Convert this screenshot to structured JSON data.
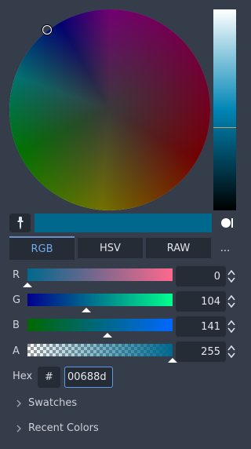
{
  "colors": {
    "panel_bg": "#363d4a",
    "control_bg": "#262c35",
    "accent": "#6ea8ef",
    "current_color": "#00688d"
  },
  "tabs": [
    {
      "label": "RGB",
      "active": true
    },
    {
      "label": "HSV",
      "active": false
    },
    {
      "label": "RAW",
      "active": false
    }
  ],
  "more_label": "...",
  "channels": [
    {
      "label": "R",
      "value": "0",
      "fraction": 0.0
    },
    {
      "label": "G",
      "value": "104",
      "fraction": 0.408
    },
    {
      "label": "B",
      "value": "141",
      "fraction": 0.553
    },
    {
      "label": "A",
      "value": "255",
      "fraction": 1.0
    }
  ],
  "hex": {
    "label": "Hex",
    "hash_label": "#",
    "value": "00688d"
  },
  "sections": [
    {
      "label": "Swatches"
    },
    {
      "label": "Recent Colors"
    }
  ],
  "icons": {
    "picker": "eyedropper-icon",
    "sample": "sample-toggle-icon",
    "spin": "spin-arrows-icon",
    "section": "chevron-right-icon"
  }
}
